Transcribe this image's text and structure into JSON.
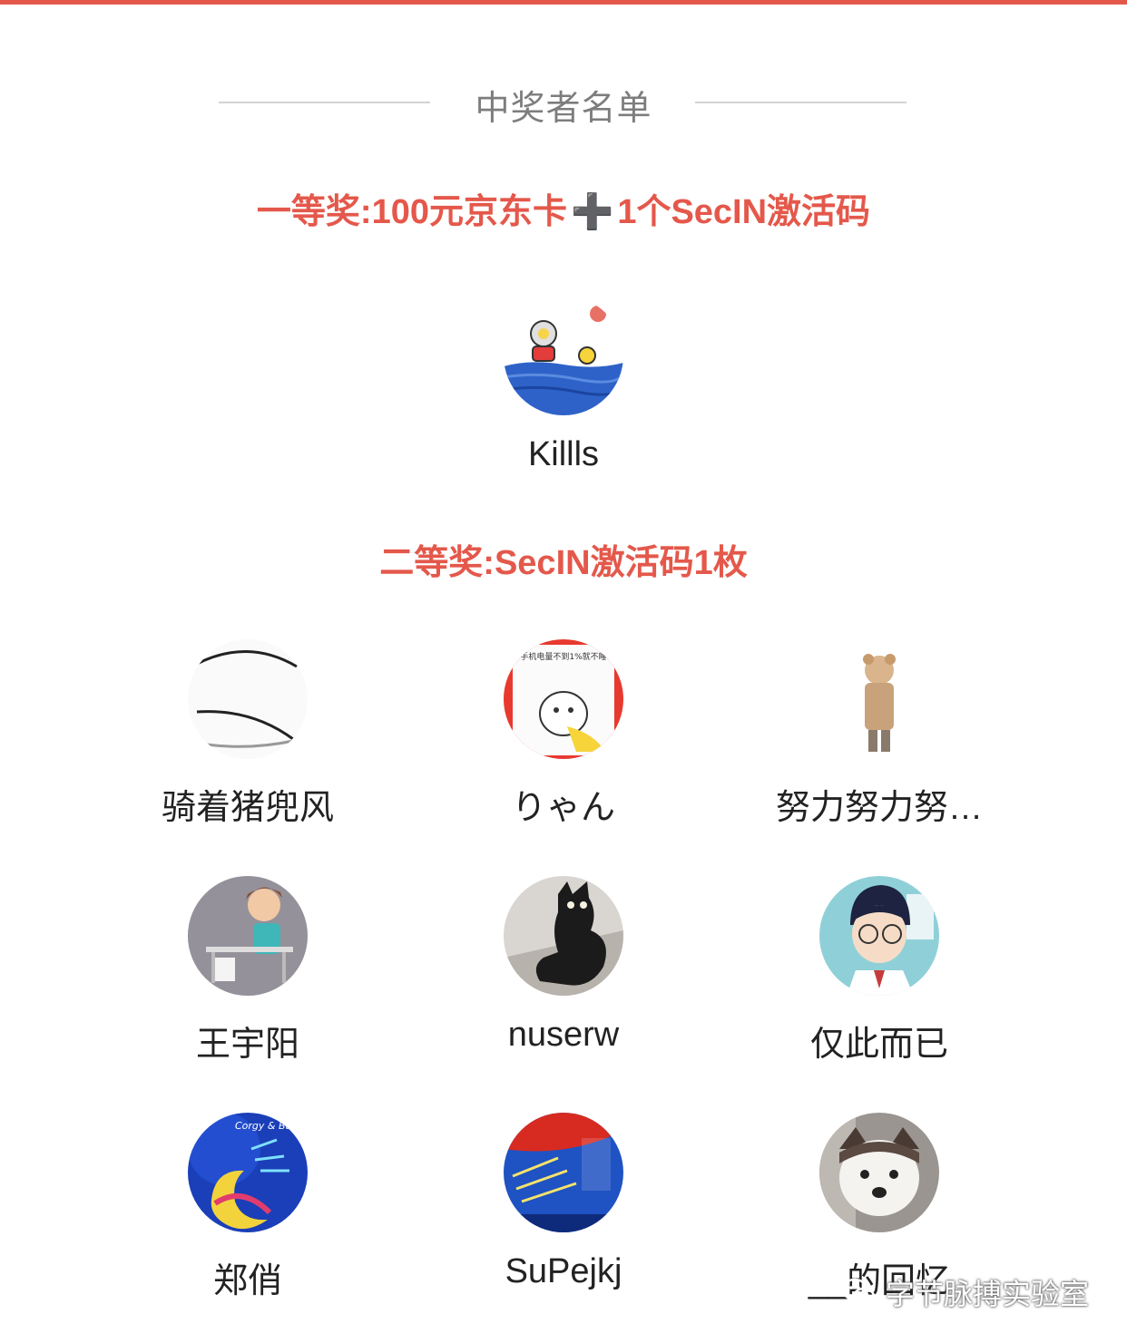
{
  "section_title": "中奖者名单",
  "first_prize": {
    "heading_part1": "一等奖:100元京东卡",
    "plus_glyph": "➕",
    "heading_part2": "1个SecIN激活码",
    "winners": [
      {
        "name": "Killls",
        "avatar": "ultraman-avatar"
      }
    ]
  },
  "second_prize": {
    "heading": "二等奖:SecIN激活码1枚",
    "winners": [
      {
        "name": "骑着猪兜风",
        "avatar": "sketch-lines-avatar"
      },
      {
        "name": "りゃん",
        "avatar": "cartoon-battery-avatar",
        "caption": "手机电量不到1%就不睡"
      },
      {
        "name": "努力努力努…",
        "avatar": "bear-girl-avatar"
      },
      {
        "name": "王宇阳",
        "avatar": "desk-coder-avatar"
      },
      {
        "name": "nuserw",
        "avatar": "black-cat-avatar"
      },
      {
        "name": "仅此而已",
        "avatar": "conan-avatar"
      },
      {
        "name": "郑俏",
        "avatar": "blue-moon-avatar",
        "caption": "Corgy & Budo"
      },
      {
        "name": "SuPejkj",
        "avatar": "parade-flag-avatar"
      },
      {
        "name": "__的回忆",
        "avatar": "puppy-avatar"
      }
    ]
  },
  "watermark": {
    "text": "字节脉搏实验室",
    "icon": "wechat-icon"
  },
  "colors": {
    "accent": "#e4584b",
    "title_gray": "#7d7d7d",
    "text": "#222222"
  }
}
